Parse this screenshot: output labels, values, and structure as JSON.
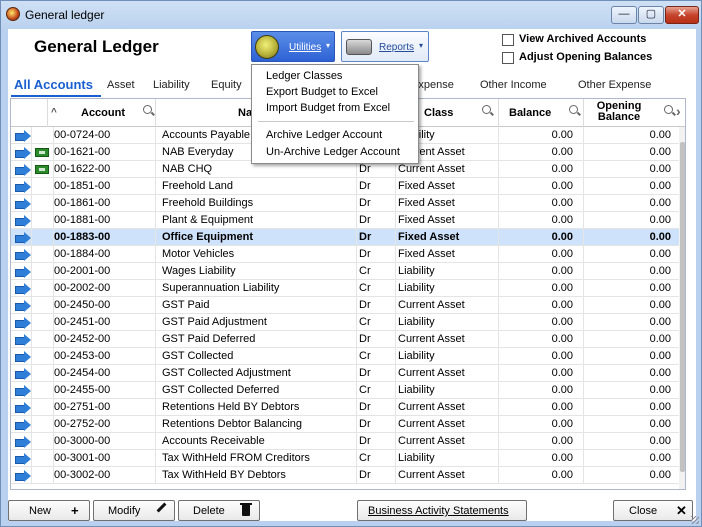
{
  "window": {
    "title": "General ledger",
    "min": "—",
    "max": "▢",
    "close": "✕"
  },
  "header": {
    "title": "General Ledger"
  },
  "toolbar": {
    "utilities_label": "Utilities",
    "reports_label": "Reports",
    "dropdown_glyph": "▾"
  },
  "options": {
    "view_archived": "View Archived Accounts",
    "adjust_opening": "Adjust Opening Balances"
  },
  "tabs": [
    "All Accounts",
    "Asset",
    "Liability",
    "Equity",
    "Expense",
    "Other Income",
    "Other Expense"
  ],
  "columns": {
    "account": "Account",
    "name": "Na",
    "class": "Class",
    "balance": "Balance",
    "opening": "Opening Balance",
    "sort_glyph": "^",
    "scroll_glyph": "›"
  },
  "utilities_menu": [
    "Ledger Classes",
    "Export Budget to Excel",
    "Import Budget from Excel",
    "Archive Ledger Account",
    "Un-Archive Ledger Account"
  ],
  "rows": [
    {
      "account": "00-0724-00",
      "name": "Accounts Payable",
      "drcr": "",
      "cls": "Liability",
      "balance": "0.00",
      "opening": "0.00",
      "bank": false,
      "selected": false
    },
    {
      "account": "00-1621-00",
      "name": "NAB Everyday",
      "drcr": "",
      "cls": "Current Asset",
      "balance": "0.00",
      "opening": "0.00",
      "bank": true,
      "selected": false
    },
    {
      "account": "00-1622-00",
      "name": "NAB CHQ",
      "drcr": "Dr",
      "cls": "Current Asset",
      "balance": "0.00",
      "opening": "0.00",
      "bank": true,
      "selected": false
    },
    {
      "account": "00-1851-00",
      "name": "Freehold Land",
      "drcr": "Dr",
      "cls": "Fixed Asset",
      "balance": "0.00",
      "opening": "0.00",
      "bank": false,
      "selected": false
    },
    {
      "account": "00-1861-00",
      "name": "Freehold Buildings",
      "drcr": "Dr",
      "cls": "Fixed Asset",
      "balance": "0.00",
      "opening": "0.00",
      "bank": false,
      "selected": false
    },
    {
      "account": "00-1881-00",
      "name": "Plant & Equipment",
      "drcr": "Dr",
      "cls": "Fixed Asset",
      "balance": "0.00",
      "opening": "0.00",
      "bank": false,
      "selected": false
    },
    {
      "account": "00-1883-00",
      "name": "Office Equipment",
      "drcr": "Dr",
      "cls": "Fixed Asset",
      "balance": "0.00",
      "opening": "0.00",
      "bank": false,
      "selected": true
    },
    {
      "account": "00-1884-00",
      "name": "Motor Vehicles",
      "drcr": "Dr",
      "cls": "Fixed Asset",
      "balance": "0.00",
      "opening": "0.00",
      "bank": false,
      "selected": false
    },
    {
      "account": "00-2001-00",
      "name": "Wages Liability",
      "drcr": "Cr",
      "cls": "Liability",
      "balance": "0.00",
      "opening": "0.00",
      "bank": false,
      "selected": false
    },
    {
      "account": "00-2002-00",
      "name": "Superannuation Liability",
      "drcr": "Cr",
      "cls": "Liability",
      "balance": "0.00",
      "opening": "0.00",
      "bank": false,
      "selected": false
    },
    {
      "account": "00-2450-00",
      "name": "GST Paid",
      "drcr": "Dr",
      "cls": "Current Asset",
      "balance": "0.00",
      "opening": "0.00",
      "bank": false,
      "selected": false
    },
    {
      "account": "00-2451-00",
      "name": "GST Paid Adjustment",
      "drcr": "Cr",
      "cls": "Liability",
      "balance": "0.00",
      "opening": "0.00",
      "bank": false,
      "selected": false
    },
    {
      "account": "00-2452-00",
      "name": "GST Paid Deferred",
      "drcr": "Dr",
      "cls": "Current Asset",
      "balance": "0.00",
      "opening": "0.00",
      "bank": false,
      "selected": false
    },
    {
      "account": "00-2453-00",
      "name": "GST Collected",
      "drcr": "Cr",
      "cls": "Liability",
      "balance": "0.00",
      "opening": "0.00",
      "bank": false,
      "selected": false
    },
    {
      "account": "00-2454-00",
      "name": "GST Collected Adjustment",
      "drcr": "Dr",
      "cls": "Current Asset",
      "balance": "0.00",
      "opening": "0.00",
      "bank": false,
      "selected": false
    },
    {
      "account": "00-2455-00",
      "name": "GST Collected Deferred",
      "drcr": "Cr",
      "cls": "Liability",
      "balance": "0.00",
      "opening": "0.00",
      "bank": false,
      "selected": false
    },
    {
      "account": "00-2751-00",
      "name": "Retentions Held BY Debtors",
      "drcr": "Dr",
      "cls": "Current Asset",
      "balance": "0.00",
      "opening": "0.00",
      "bank": false,
      "selected": false
    },
    {
      "account": "00-2752-00",
      "name": "Retentions Debtor Balancing",
      "drcr": "Dr",
      "cls": "Current Asset",
      "balance": "0.00",
      "opening": "0.00",
      "bank": false,
      "selected": false
    },
    {
      "account": "00-3000-00",
      "name": "Accounts Receivable",
      "drcr": "Dr",
      "cls": "Current Asset",
      "balance": "0.00",
      "opening": "0.00",
      "bank": false,
      "selected": false
    },
    {
      "account": "00-3001-00",
      "name": "Tax WithHeld FROM Creditors",
      "drcr": "Cr",
      "cls": "Liability",
      "balance": "0.00",
      "opening": "0.00",
      "bank": false,
      "selected": false
    },
    {
      "account": "00-3002-00",
      "name": "Tax WithHeld BY Debtors",
      "drcr": "Dr",
      "cls": "Current Asset",
      "balance": "0.00",
      "opening": "0.00",
      "bank": false,
      "selected": false
    }
  ],
  "footer": {
    "new": "New",
    "new_icon": "+",
    "modify": "Modify",
    "delete": "Delete",
    "bas": "Business Activity Statements",
    "close": "Close",
    "close_icon": "✕"
  },
  "colors": {
    "accent": "#1a5fd0",
    "selected_row": "#cfe2fb",
    "utilities_bg": "#2e62d4"
  }
}
